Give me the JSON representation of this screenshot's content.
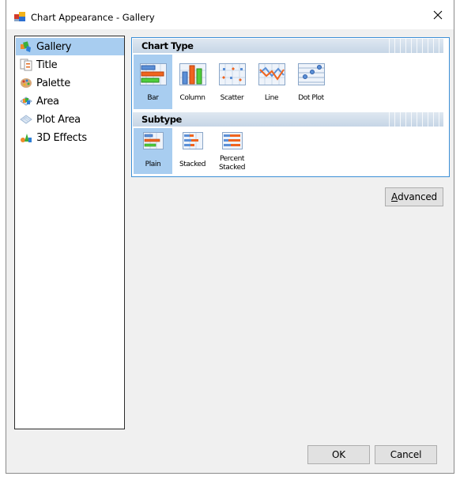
{
  "window": {
    "title": "Chart Appearance - Gallery",
    "app_icon": "chart-appearance-app-icon",
    "close_icon": "close-icon"
  },
  "nav": {
    "items": [
      {
        "label": "Gallery",
        "icon": "gallery-icon",
        "selected": true
      },
      {
        "label": "Title",
        "icon": "title-icon",
        "selected": false
      },
      {
        "label": "Palette",
        "icon": "palette-icon",
        "selected": false
      },
      {
        "label": "Area",
        "icon": "area-icon",
        "selected": false
      },
      {
        "label": "Plot Area",
        "icon": "plot-area-icon",
        "selected": false
      },
      {
        "label": "3D Effects",
        "icon": "3d-effects-icon",
        "selected": false
      }
    ]
  },
  "gallery": {
    "chart_type_header": "Chart Type",
    "chart_types": [
      {
        "label": "Bar",
        "icon": "bar-chart-icon",
        "selected": true
      },
      {
        "label": "Column",
        "icon": "column-chart-icon",
        "selected": false
      },
      {
        "label": "Scatter",
        "icon": "scatter-chart-icon",
        "selected": false
      },
      {
        "label": "Line",
        "icon": "line-chart-icon",
        "selected": false
      },
      {
        "label": "Dot Plot",
        "icon": "dot-plot-chart-icon",
        "selected": false
      }
    ],
    "subtype_header": "Subtype",
    "subtypes": [
      {
        "label": "Plain",
        "label2": "",
        "icon": "plain-bar-icon",
        "selected": true
      },
      {
        "label": "Stacked",
        "label2": "",
        "icon": "stacked-bar-icon",
        "selected": false
      },
      {
        "label": "Percent",
        "label2": "Stacked",
        "icon": "percent-stacked-bar-icon",
        "selected": false
      }
    ]
  },
  "buttons": {
    "advanced_mnemonic": "A",
    "advanced_rest": "dvanced",
    "ok": "OK",
    "cancel": "Cancel"
  },
  "colors": {
    "selection": "#a8cdf0",
    "gallery_border": "#3c8fd6",
    "dialog_bg": "#f0f0f0"
  }
}
